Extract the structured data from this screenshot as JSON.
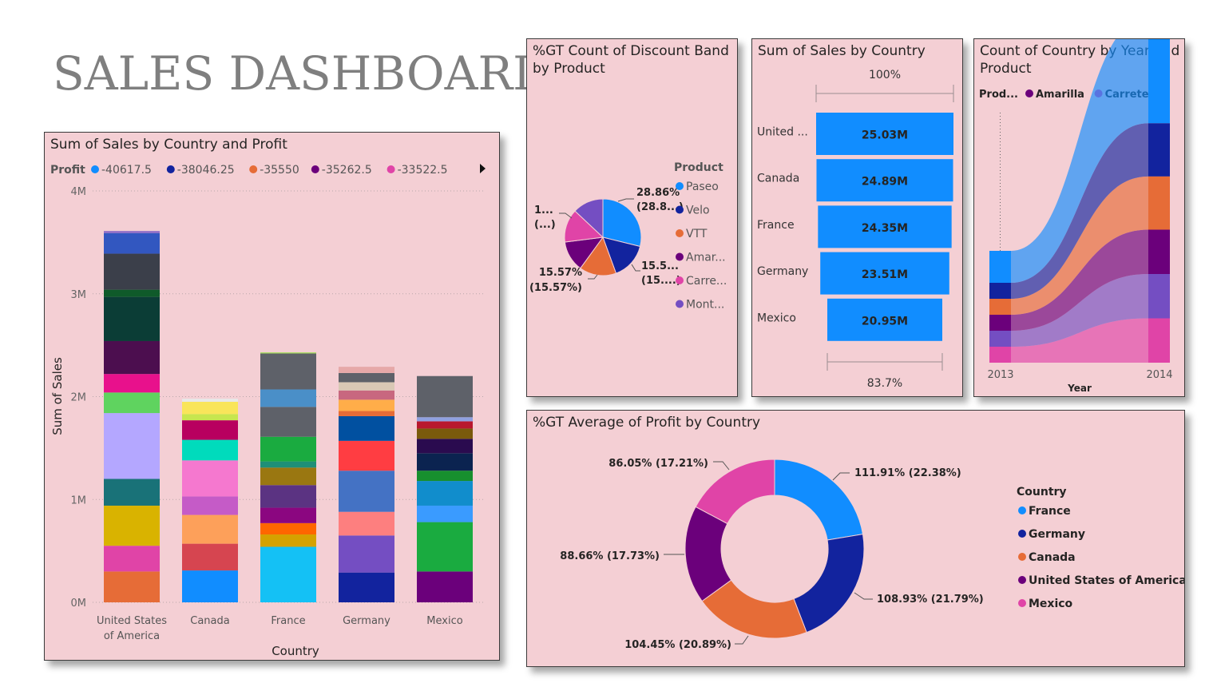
{
  "page_title": "SALES DASHBOARD",
  "colors": {
    "panel_bg": "#f4cfd4",
    "blue": "#118dff",
    "navy": "#12239e",
    "orange": "#e66c37",
    "purple": "#6b007b",
    "pink": "#e044a7",
    "violet": "#744ec2"
  },
  "chart_data": [
    {
      "id": "sales-country-profit",
      "type": "bar",
      "stacked": true,
      "title": "Sum of Sales by Country and Profit",
      "legend_title": "Profit",
      "legend": [
        "-40617.5",
        "-38046.25",
        "-35550",
        "-35262.5",
        "-33522.5"
      ],
      "legend_colors": [
        "#118dff",
        "#12239e",
        "#e66c37",
        "#6b007b",
        "#e044a7"
      ],
      "xlabel": "Country",
      "ylabel": "Sum of Sales",
      "ylim": [
        0,
        4000000
      ],
      "yticks": [
        {
          "v": 0,
          "label": "0M"
        },
        {
          "v": 1000000,
          "label": "1M"
        },
        {
          "v": 2000000,
          "label": "2M"
        },
        {
          "v": 3000000,
          "label": "3M"
        },
        {
          "v": 4000000,
          "label": "4M"
        }
      ],
      "grid": true,
      "categories": [
        "United States of America",
        "Canada",
        "France",
        "Germany",
        "Mexico"
      ],
      "category_lines": [
        [
          "United States",
          "of America"
        ],
        [
          "Canada"
        ],
        [
          "France"
        ],
        [
          "Germany"
        ],
        [
          "Mexico"
        ]
      ],
      "totals": [
        3610000,
        1980000,
        2430000,
        2290000,
        2200000
      ],
      "segments": [
        [
          {
            "v": 300000,
            "c": "#e66c37"
          },
          {
            "v": 250000,
            "c": "#e044a7"
          },
          {
            "v": 390000,
            "c": "#d9b300"
          },
          {
            "v": 260000,
            "c": "#197278"
          },
          {
            "v": 640000,
            "c": "#b4a7ff"
          },
          {
            "v": 200000,
            "c": "#5fd35f"
          },
          {
            "v": 180000,
            "c": "#e8118c"
          },
          {
            "v": 320000,
            "c": "#4c0e4f"
          },
          {
            "v": 430000,
            "c": "#0b3d36"
          },
          {
            "v": 70000,
            "c": "#0f5a2a"
          },
          {
            "v": 350000,
            "c": "#3b3f4a"
          },
          {
            "v": 200000,
            "c": "#3257c0"
          },
          {
            "v": 20000,
            "c": "#8c6bc8"
          }
        ],
        [
          {
            "v": 310000,
            "c": "#118dff"
          },
          {
            "v": 260000,
            "c": "#d64550"
          },
          {
            "v": 280000,
            "c": "#fda05a"
          },
          {
            "v": 180000,
            "c": "#c55bc7"
          },
          {
            "v": 350000,
            "c": "#f578cf"
          },
          {
            "v": 200000,
            "c": "#00dbbc"
          },
          {
            "v": 190000,
            "c": "#b8005f"
          },
          {
            "v": 60000,
            "c": "#c7e64f"
          },
          {
            "v": 120000,
            "c": "#f9e55a"
          },
          {
            "v": 30000,
            "c": "#e8e8e8"
          }
        ],
        [
          {
            "v": 540000,
            "c": "#14c1f5"
          },
          {
            "v": 120000,
            "c": "#d5a200"
          },
          {
            "v": 110000,
            "c": "#ff6600"
          },
          {
            "v": 150000,
            "c": "#8b0680"
          },
          {
            "v": 220000,
            "c": "#5b3382"
          },
          {
            "v": 170000,
            "c": "#9a7711"
          },
          {
            "v": 60000,
            "c": "#1f8f77"
          },
          {
            "v": 240000,
            "c": "#1aab40"
          },
          {
            "v": 290000,
            "c": "#5e6169"
          },
          {
            "v": 170000,
            "c": "#4a8fc8"
          },
          {
            "v": 350000,
            "c": "#5e6169"
          },
          {
            "v": 10000,
            "c": "#a4df5a"
          }
        ],
        [
          {
            "v": 290000,
            "c": "#12239e"
          },
          {
            "v": 360000,
            "c": "#744ec2"
          },
          {
            "v": 230000,
            "c": "#fd7f7f"
          },
          {
            "v": 400000,
            "c": "#4472c4"
          },
          {
            "v": 290000,
            "c": "#ff3d42"
          },
          {
            "v": 240000,
            "c": "#0150a0"
          },
          {
            "v": 50000,
            "c": "#e66c37"
          },
          {
            "v": 110000,
            "c": "#ffad49"
          },
          {
            "v": 90000,
            "c": "#c8677f"
          },
          {
            "v": 80000,
            "c": "#d9c8b5"
          },
          {
            "v": 90000,
            "c": "#5e6169"
          },
          {
            "v": 60000,
            "c": "#e6a8a8"
          }
        ],
        [
          {
            "v": 300000,
            "c": "#6b007b"
          },
          {
            "v": 480000,
            "c": "#1aab40"
          },
          {
            "v": 160000,
            "c": "#3a9bff"
          },
          {
            "v": 240000,
            "c": "#118dcc"
          },
          {
            "v": 100000,
            "c": "#178f2e"
          },
          {
            "v": 170000,
            "c": "#0b2350"
          },
          {
            "v": 140000,
            "c": "#2a0b4f"
          },
          {
            "v": 100000,
            "c": "#7a5a0c"
          },
          {
            "v": 70000,
            "c": "#b8182e"
          },
          {
            "v": 40000,
            "c": "#8fa0e0"
          },
          {
            "v": 400000,
            "c": "#5e6169"
          }
        ]
      ]
    },
    {
      "id": "gt-discount-band",
      "type": "pie",
      "title": "%GT Count of Discount Band by Product",
      "legend_title": "Product",
      "legend": [
        "Paseo",
        "Velo",
        "VTT",
        "Amar...",
        "Carre...",
        "Mont..."
      ],
      "labels": [
        "Paseo",
        "Velo",
        "VTT",
        "Amarilla",
        "Carretera",
        "Montana"
      ],
      "values": [
        28.86,
        15.57,
        15.57,
        13.0,
        14.0,
        13.0
      ],
      "colors": [
        "#118dff",
        "#12239e",
        "#e66c37",
        "#6b007b",
        "#e044a7",
        "#744ec2"
      ],
      "data_labels": [
        {
          "lines": [
            "28.86%",
            "(28.8...)"
          ]
        },
        {
          "lines": [
            "15.5...",
            "(15....)"
          ]
        },
        {
          "lines": [
            "15.57%",
            "(15.57%)"
          ]
        },
        {
          "lines": [
            "1...",
            "(...)"
          ]
        }
      ]
    },
    {
      "id": "sales-by-country",
      "type": "bar",
      "subtype": "funnel",
      "title": "Sum of Sales by Country",
      "categories": [
        "United ...",
        "Canada",
        "France",
        "Germany",
        "Mexico"
      ],
      "values": [
        25.03,
        24.89,
        24.35,
        23.51,
        20.95
      ],
      "value_labels": [
        "25.03M",
        "24.89M",
        "24.35M",
        "23.51M",
        "20.95M"
      ],
      "unit": "M",
      "top_label": "100%",
      "bottom_label": "83.7%",
      "color": "#118dff"
    },
    {
      "id": "count-country-year-product",
      "type": "area",
      "subtype": "ribbon",
      "title": "Count of Country by Year and Product",
      "legend_title": "Prod...",
      "legend": [
        "Amarilla",
        "Carretera"
      ],
      "legend_colors": [
        "#6b007b",
        "#e044a7"
      ],
      "x": [
        "2013",
        "2014"
      ],
      "xlabel": "Year",
      "series_order": [
        "Paseo",
        "Velo",
        "VTT",
        "Amarilla",
        "Montana",
        "Carretera"
      ],
      "colors": [
        "#118dff",
        "#12239e",
        "#e66c37",
        "#6b007b",
        "#744ec2",
        "#e044a7"
      ],
      "values_2013": [
        4,
        2,
        2,
        2,
        2,
        2
      ],
      "values_2014": [
        12,
        6,
        6,
        5,
        5,
        5
      ]
    },
    {
      "id": "gt-avg-profit-country",
      "type": "pie",
      "subtype": "donut",
      "title": "%GT Average of Profit by Country",
      "legend_title": "Country",
      "labels": [
        "France",
        "Germany",
        "Canada",
        "United States of America",
        "Mexico"
      ],
      "values": [
        22.38,
        21.79,
        20.89,
        17.73,
        17.21
      ],
      "colors": [
        "#118dff",
        "#12239e",
        "#e66c37",
        "#6b007b",
        "#e044a7"
      ],
      "data_labels": [
        "111.91% (22.38%)",
        "108.93% (21.79%)",
        "104.45% (20.89%)",
        "88.66% (17.73%)",
        "86.05% (17.21%)"
      ]
    }
  ]
}
